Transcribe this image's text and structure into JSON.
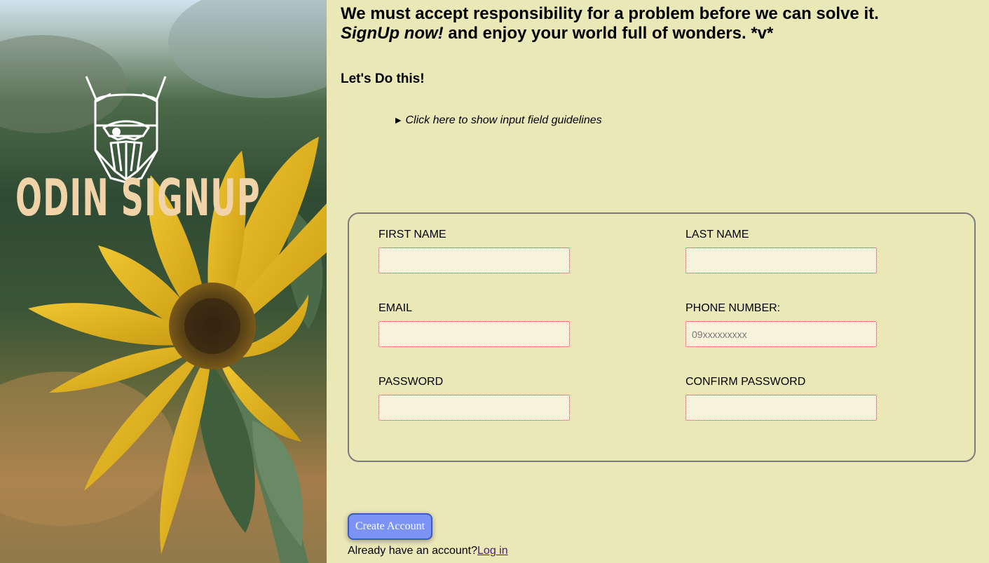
{
  "hero": {
    "brand": "ODIN SIGNUP"
  },
  "header": {
    "line1": "We must accept responsibility for a problem before we can solve it.",
    "line2_emphasis": "SignUp now!",
    "line2_rest": " and enjoy your world full of wonders. *v*"
  },
  "subhead": "Let's Do this!",
  "guidelines": {
    "label": "Click here to show input field guidelines"
  },
  "form": {
    "first_name": {
      "label": "FIRST NAME",
      "value": "",
      "placeholder": ""
    },
    "last_name": {
      "label": "LAST NAME",
      "value": "",
      "placeholder": ""
    },
    "email": {
      "label": "EMAIL",
      "value": "",
      "placeholder": ""
    },
    "phone": {
      "label": "PHONE NUMBER:",
      "value": "",
      "placeholder": "09xxxxxxxxx"
    },
    "password": {
      "label": "PASSWORD",
      "value": "",
      "placeholder": ""
    },
    "confirm_password": {
      "label": "CONFIRM PASSWORD",
      "value": "",
      "placeholder": ""
    }
  },
  "actions": {
    "create_label": "Create Account",
    "login_prompt": "Already have an account?",
    "login_link": "Log in"
  },
  "colors": {
    "background": "#ebe8b8",
    "brand": "#f0d3a8",
    "button": "#7b93f5",
    "input_border": "#c04050"
  }
}
